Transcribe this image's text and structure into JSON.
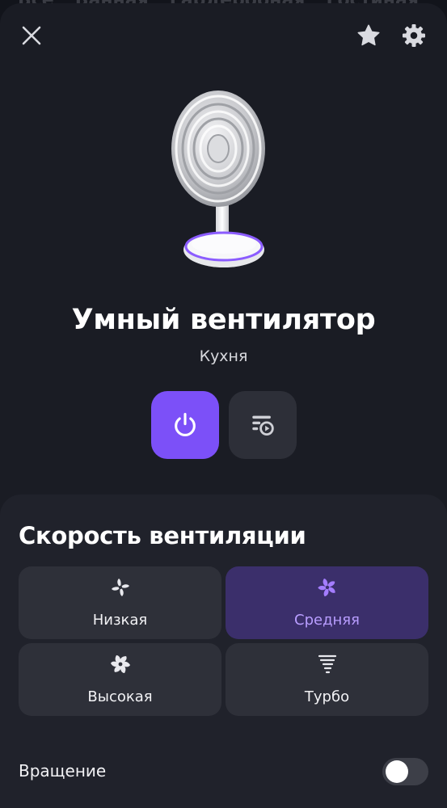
{
  "background_tabs": [
    "Все",
    "Ванная",
    "Гардеробная",
    "Гостиная"
  ],
  "device": {
    "name": "Умный вентилятор",
    "room": "Кухня",
    "image_icon": "desk-fan-image"
  },
  "header": {
    "close_icon": "close-icon",
    "favorite_icon": "star-icon",
    "settings_icon": "gear-icon"
  },
  "actions": {
    "power": {
      "icon": "power-icon",
      "state": "on"
    },
    "scenarios": {
      "icon": "scenario-list-icon"
    }
  },
  "speed_panel": {
    "title": "Скорость вентиляции",
    "options": [
      {
        "label": "Низкая",
        "icon": "fan-low-icon",
        "selected": false
      },
      {
        "label": "Средняя",
        "icon": "fan-medium-icon",
        "selected": true
      },
      {
        "label": "Высокая",
        "icon": "fan-high-icon",
        "selected": false
      },
      {
        "label": "Турбо",
        "icon": "tornado-icon",
        "selected": false
      }
    ]
  },
  "rotation": {
    "label": "Вращение",
    "enabled": false
  },
  "colors": {
    "accent": "#7c50f8",
    "accent_text": "#b89dff",
    "selected_bg": "#3b2f6b",
    "background": "#12141b",
    "panel": "#20222b",
    "button": "#2e3039"
  }
}
